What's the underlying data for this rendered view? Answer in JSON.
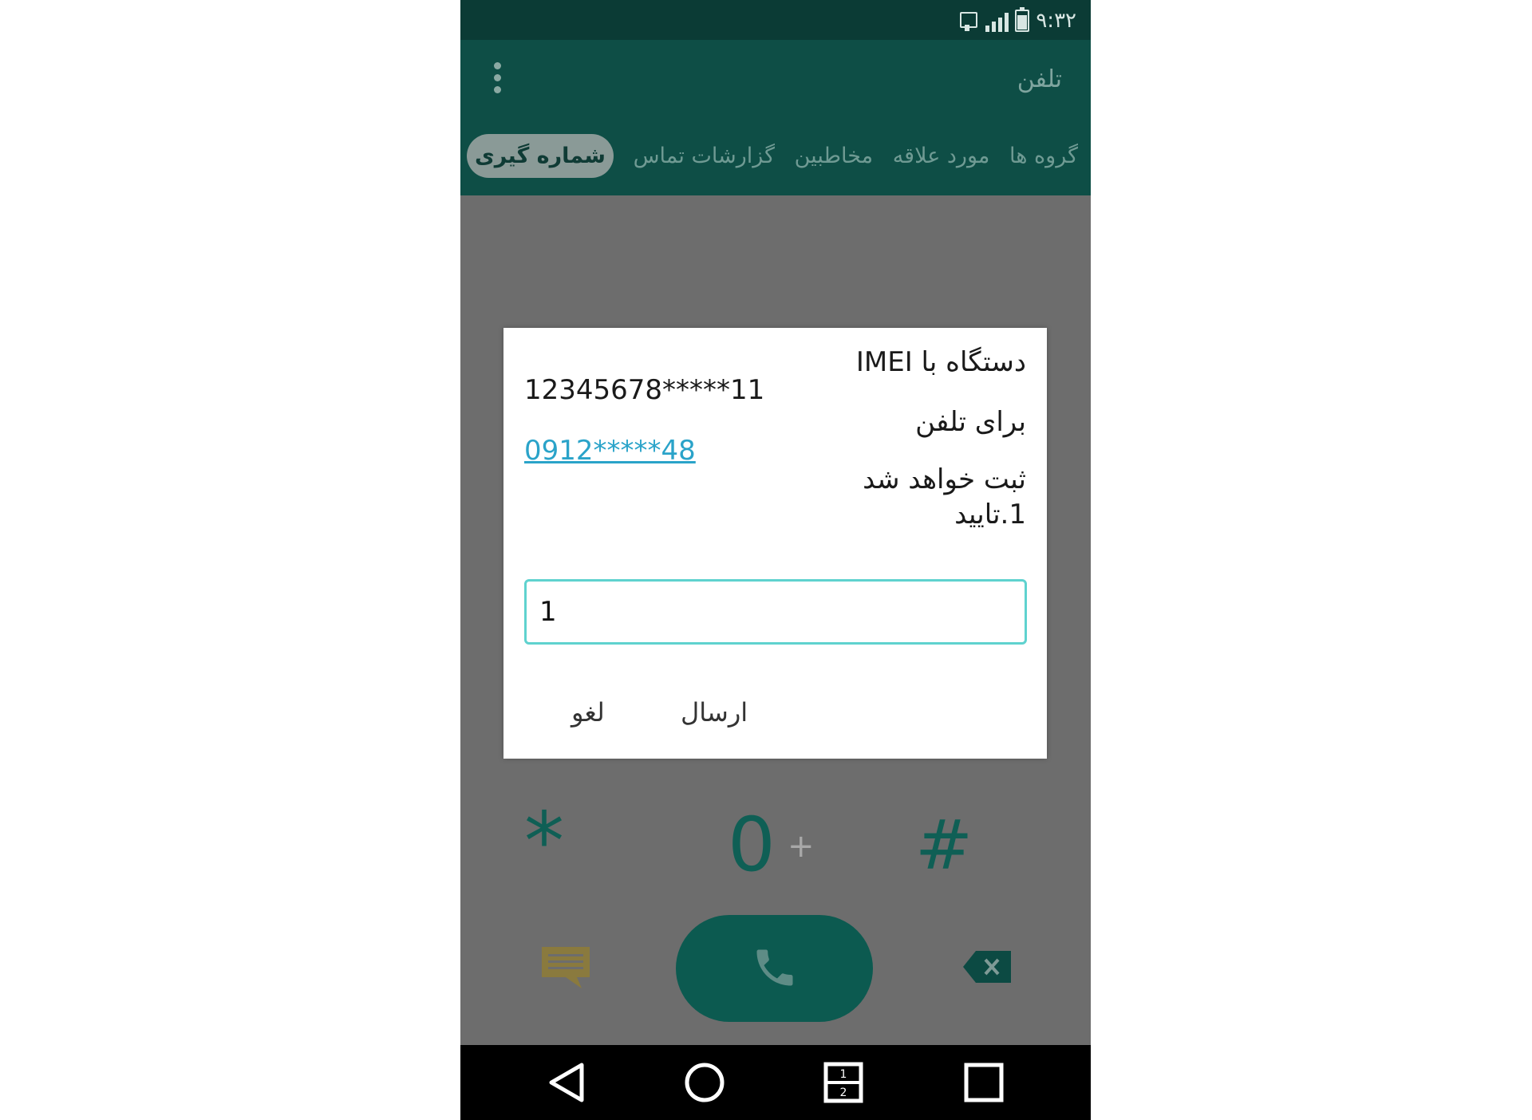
{
  "status_bar": {
    "time": "۹:۳۲"
  },
  "app_bar": {
    "title": "تلفن",
    "tabs": [
      {
        "label": "گروه ها"
      },
      {
        "label": "مورد علاقه"
      },
      {
        "label": "مخاطبین"
      },
      {
        "label": "گزارشات تماس"
      },
      {
        "label": "شماره گیری",
        "active": true
      }
    ]
  },
  "dialpad": {
    "keys": [
      "*",
      "0",
      "+",
      "#"
    ]
  },
  "dialog": {
    "line1": "دستگاه با IMEI",
    "imei": "12345678*****11",
    "line2": "برای تلفن",
    "phone_number": "0912*****48",
    "line3": "ثبت خواهد شد",
    "line4": "1.تایید",
    "input_value": "1",
    "send_label": "ارسال",
    "cancel_label": "لغو"
  },
  "colors": {
    "app_bar": "#0e4e46",
    "status_bar": "#0b3b35",
    "accent": "#5fd2cf",
    "link": "#2aa3c9",
    "call_button": "#0c5a50"
  }
}
